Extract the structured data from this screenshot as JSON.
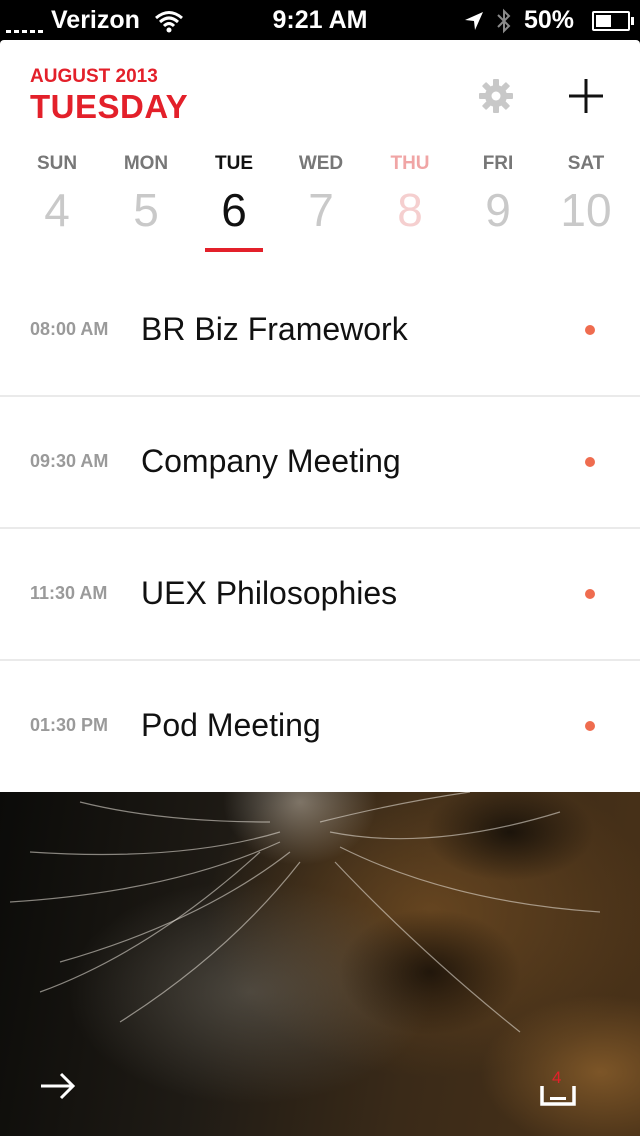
{
  "status_bar": {
    "carrier": "Verizon",
    "time": "9:21 AM",
    "battery": "50%",
    "battery_level": 0.5
  },
  "header": {
    "month_year": "AUGUST 2013",
    "weekday": "TUESDAY"
  },
  "colors": {
    "accent": "#e3202a",
    "event_dot": "#ef6c4f",
    "muted": "#c9c9c9"
  },
  "week": [
    {
      "name": "SUN",
      "date": "4"
    },
    {
      "name": "MON",
      "date": "5"
    },
    {
      "name": "TUE",
      "date": "6"
    },
    {
      "name": "WED",
      "date": "7"
    },
    {
      "name": "THU",
      "date": "8"
    },
    {
      "name": "FRI",
      "date": "9"
    },
    {
      "name": "SAT",
      "date": "10"
    }
  ],
  "events": [
    {
      "time": "08:00 AM",
      "title": "BR Biz Framework"
    },
    {
      "time": "09:30 AM",
      "title": "Company Meeting"
    },
    {
      "time": "11:30 AM",
      "title": "UEX Philosophies"
    },
    {
      "time": "01:30 PM",
      "title": "Pod Meeting"
    }
  ],
  "footer": {
    "inbox_count": "4"
  },
  "icons": {
    "settings": "gear-icon",
    "add": "plus-icon",
    "next": "arrow-right-icon",
    "inbox": "inbox-tray-icon"
  }
}
